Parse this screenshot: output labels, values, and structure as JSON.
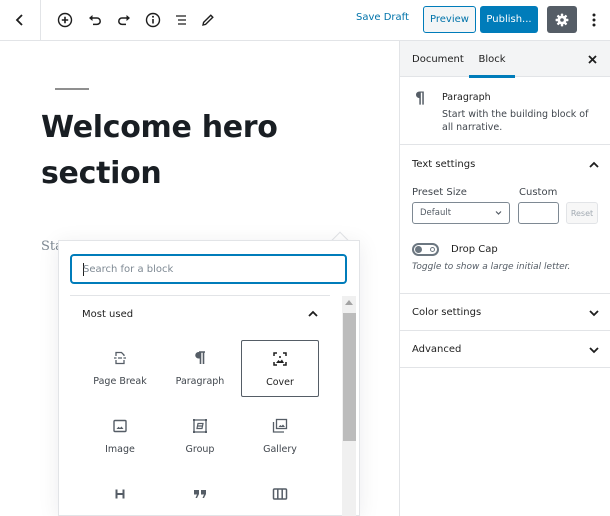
{
  "toolbar": {
    "back_icon": "chevron-left-icon",
    "icons": [
      "add-block-icon",
      "undo-icon",
      "redo-icon",
      "info-icon",
      "block-navigation-icon",
      "tools-edit-icon"
    ],
    "save_draft_label": "Save Draft",
    "preview_label": "Preview",
    "publish_label": "Publish...",
    "settings_icon": "gear-icon",
    "more_icon": "more-vertical-icon"
  },
  "editor": {
    "title": "Welcome hero section",
    "paragraph_placeholder": "Start writing or type / to choose a block"
  },
  "inserter": {
    "search_placeholder": "Search for a block",
    "search_value": "",
    "panel_title": "Most used",
    "panel_expanded": true,
    "blocks": [
      {
        "label": "Page Break",
        "icon": "page-break-icon",
        "selected": false
      },
      {
        "label": "Paragraph",
        "icon": "paragraph-icon",
        "selected": false
      },
      {
        "label": "Cover",
        "icon": "cover-icon",
        "selected": true
      },
      {
        "label": "Image",
        "icon": "image-icon",
        "selected": false
      },
      {
        "label": "Group",
        "icon": "group-icon",
        "selected": false
      },
      {
        "label": "Gallery",
        "icon": "gallery-icon",
        "selected": false
      },
      {
        "label": "",
        "icon": "heading-icon",
        "selected": false
      },
      {
        "label": "",
        "icon": "quote-icon",
        "selected": false
      },
      {
        "label": "",
        "icon": "columns-icon",
        "selected": false
      }
    ]
  },
  "sidebar": {
    "tabs": [
      {
        "label": "Document",
        "active": false
      },
      {
        "label": "Block",
        "active": true
      }
    ],
    "close_icon": "close-icon",
    "block_card": {
      "icon": "¶",
      "title": "Paragraph",
      "description": "Start with the building block of all narrative."
    },
    "text_settings": {
      "title": "Text settings",
      "expanded": true,
      "preset_size_label": "Preset Size",
      "preset_size_value": "Default",
      "custom_label": "Custom",
      "custom_value": "",
      "reset_label": "Reset",
      "drop_cap_label": "Drop Cap",
      "drop_cap_enabled": false,
      "drop_cap_help": "Toggle to show a large initial letter."
    },
    "color_settings": {
      "title": "Color settings",
      "expanded": false
    },
    "advanced": {
      "title": "Advanced",
      "expanded": false
    }
  },
  "colors": {
    "accent": "#007cba",
    "link": "#0073aa",
    "settings_button": "#555d66"
  }
}
